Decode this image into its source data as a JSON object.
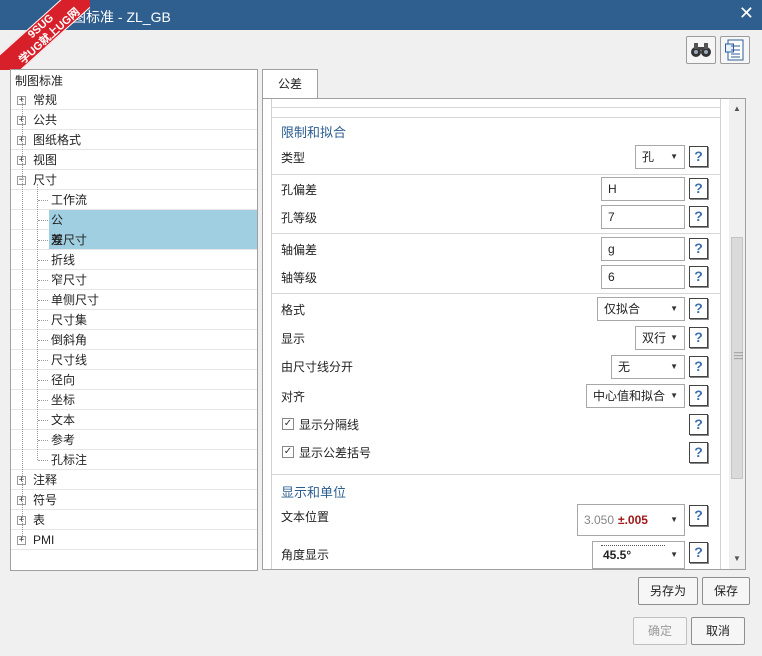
{
  "window": {
    "title": "图标准 - ZL_GB",
    "close_glyph": "✕",
    "watermark_line1": "9SUG",
    "watermark_line2": "学UG就上UG网"
  },
  "toolbar": {
    "binoculars_icon": "binoculars-icon",
    "settings_sheet_icon": "sheet-icon"
  },
  "tree": {
    "root": "制图标准",
    "items": [
      {
        "label": "常规",
        "expander": "+"
      },
      {
        "label": "公共",
        "expander": "+"
      },
      {
        "label": "图纸格式",
        "expander": "+"
      },
      {
        "label": "视图",
        "expander": "+"
      },
      {
        "label": "尺寸",
        "expander": "−"
      },
      {
        "label": "工作流",
        "child": true
      },
      {
        "label": "公差",
        "child": true,
        "selected": true
      },
      {
        "label": "双尺寸",
        "child": true
      },
      {
        "label": "折线",
        "child": true
      },
      {
        "label": "窄尺寸",
        "child": true
      },
      {
        "label": "单侧尺寸",
        "child": true
      },
      {
        "label": "尺寸集",
        "child": true
      },
      {
        "label": "倒斜角",
        "child": true
      },
      {
        "label": "尺寸线",
        "child": true
      },
      {
        "label": "径向",
        "child": true
      },
      {
        "label": "坐标",
        "child": true
      },
      {
        "label": "文本",
        "child": true
      },
      {
        "label": "参考",
        "child": true
      },
      {
        "label": "孔标注",
        "child": true
      },
      {
        "label": "注释",
        "expander": "+"
      },
      {
        "label": "符号",
        "expander": "+"
      },
      {
        "label": "表",
        "expander": "+"
      },
      {
        "label": "PMI",
        "expander": "+"
      }
    ]
  },
  "tab": {
    "label": "公差"
  },
  "section1": {
    "title": "限制和拟合",
    "type_label": "类型",
    "type_value": "孔",
    "hole_dev_label": "孔偏差",
    "hole_dev_value": "H",
    "hole_grade_label": "孔等级",
    "hole_grade_value": "7",
    "shaft_dev_label": "轴偏差",
    "shaft_dev_value": "g",
    "shaft_grade_label": "轴等级",
    "shaft_grade_value": "6",
    "format_label": "格式",
    "format_value": "仅拟合",
    "display_label": "显示",
    "display_value": "双行",
    "split_label": "由尺寸线分开",
    "split_value": "无",
    "align_label": "对齐",
    "align_value": "中心值和拟合",
    "show_divider_label": "显示分隔线",
    "show_divider_checked": true,
    "show_paren_label": "显示公差括号",
    "show_paren_checked": true
  },
  "section2": {
    "title": "显示和单位",
    "text_pos_label": "文本位置",
    "text_pos_value": "3.050",
    "text_pos_tol": "±.005",
    "angle_label": "角度显示",
    "angle_value": "45.5°"
  },
  "help_glyph": "?",
  "check_glyph": "✓",
  "dropdown_glyph": "▼",
  "buttons": {
    "save_as": "另存为",
    "save": "保存",
    "ok": "确定",
    "cancel": "取消"
  },
  "colors": {
    "titlebar": "#2f5f8e",
    "section_title": "#2b5d8f",
    "selection": "#9fcfe0"
  }
}
